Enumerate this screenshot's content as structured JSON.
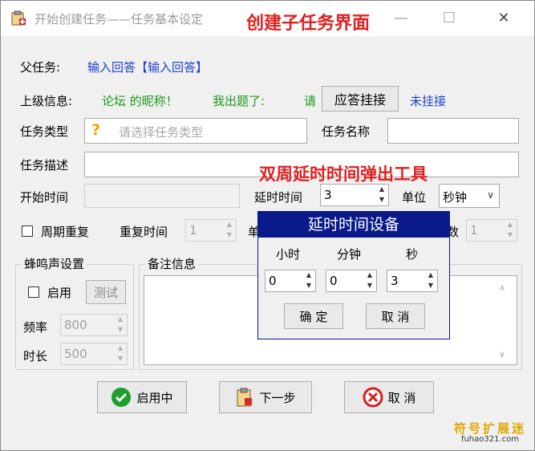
{
  "window": {
    "title": "开始创建任务——任务基本设定",
    "annotation_top": "创建子任务界面",
    "annotation_mid": "双周延时时间弹出工具",
    "controls": {
      "minimize": "—",
      "maximize": "☐",
      "close": "✕"
    }
  },
  "info": {
    "parent_label": "父任务:",
    "parent_value": "输入回答【输入回答】",
    "upper_label": "上级信息:",
    "upper_value_1": "论坛 的昵称！",
    "upper_value_2": "我出题了:",
    "upper_value_3": "请",
    "reply_button": "应答挂接",
    "unlinked": "未挂接"
  },
  "task": {
    "type_label": "任务类型",
    "type_placeholder": "请选择任务类型",
    "name_label": "任务名称",
    "name_value": "",
    "desc_label": "任务描述",
    "desc_value": ""
  },
  "timing": {
    "start_label": "开始时间",
    "start_value": "",
    "delay_label": "延时时间",
    "delay_value": "3",
    "unit_label": "单位",
    "unit_value": "秒钟",
    "repeat_checkbox": "周期重复",
    "repeat_time_label": "重复时间",
    "repeat_time_value": "1",
    "repeat_unit_partial": "单",
    "count_partial": "数",
    "count_value": "1"
  },
  "buzzer": {
    "group_label": "蜂鸣声设置",
    "enable_checkbox": "启用",
    "test_button": "测试",
    "freq_label": "频率",
    "freq_value": "800",
    "duration_label": "时长",
    "duration_value": "500"
  },
  "notes": {
    "group_label": "备注信息"
  },
  "delay_dialog": {
    "title": "延时时间设备",
    "hour_label": "小时",
    "minute_label": "分钟",
    "second_label": "秒",
    "hour_value": "0",
    "minute_value": "0",
    "second_value": "3",
    "ok_button": "确 定",
    "cancel_button": "取 消"
  },
  "footer": {
    "enable_button": "启用中",
    "next_button": "下一步",
    "cancel_button": "取 消"
  },
  "watermark": {
    "main": "符号扩展迷",
    "sub": "fuhao321.com"
  }
}
